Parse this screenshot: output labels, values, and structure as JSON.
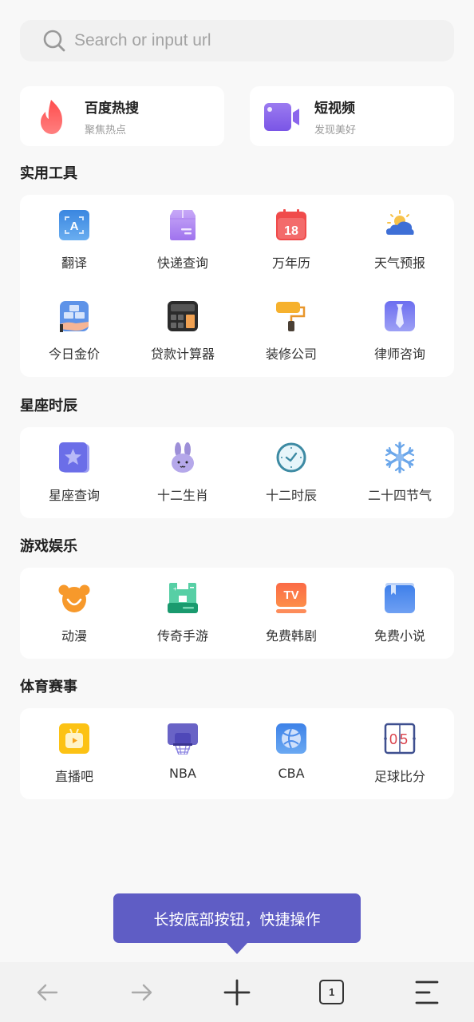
{
  "search": {
    "placeholder": "Search or input url",
    "value": ""
  },
  "features": [
    {
      "title": "百度热搜",
      "subtitle": "聚焦热点",
      "icon": "flame-icon"
    },
    {
      "title": "短视频",
      "subtitle": "发现美好",
      "icon": "video-camera-icon"
    }
  ],
  "sections": [
    {
      "title": "实用工具",
      "items": [
        {
          "label": "翻译",
          "icon": "translate-icon"
        },
        {
          "label": "快递查询",
          "icon": "package-icon"
        },
        {
          "label": "万年历",
          "icon": "calendar-icon",
          "icon_text": "18"
        },
        {
          "label": "天气预报",
          "icon": "weather-icon"
        },
        {
          "label": "今日金价",
          "icon": "gold-bars-icon"
        },
        {
          "label": "贷款计算器",
          "icon": "calculator-icon"
        },
        {
          "label": "装修公司",
          "icon": "paint-roller-icon"
        },
        {
          "label": "律师咨询",
          "icon": "necktie-icon"
        }
      ]
    },
    {
      "title": "星座时辰",
      "items": [
        {
          "label": "星座查询",
          "icon": "star-icon"
        },
        {
          "label": "十二生肖",
          "icon": "rabbit-icon"
        },
        {
          "label": "十二时辰",
          "icon": "clock-icon"
        },
        {
          "label": "二十四节气",
          "icon": "snowflake-icon"
        }
      ]
    },
    {
      "title": "游戏娱乐",
      "items": [
        {
          "label": "动漫",
          "icon": "bear-face-icon"
        },
        {
          "label": "传奇手游",
          "icon": "game-castle-icon"
        },
        {
          "label": "免费韩剧",
          "icon": "tv-icon",
          "icon_text": "TV"
        },
        {
          "label": "免费小说",
          "icon": "book-icon"
        }
      ]
    },
    {
      "title": "体育赛事",
      "items": [
        {
          "label": "直播吧",
          "icon": "live-tv-icon"
        },
        {
          "label": "NBA",
          "icon": "basketball-hoop-icon"
        },
        {
          "label": "CBA",
          "icon": "basketball-icon"
        },
        {
          "label": "足球比分",
          "icon": "scoreboard-icon",
          "icon_text": "05"
        }
      ]
    }
  ],
  "tooltip": {
    "text": "长按底部按钮，快捷操作"
  },
  "bottom_bar": {
    "tab_count": "1",
    "buttons": [
      "back-arrow-icon",
      "forward-arrow-icon",
      "plus-icon",
      "tabs-icon",
      "menu-icon"
    ]
  },
  "colors": {
    "accent": "#5f5dc5",
    "background": "#f8f8f8",
    "card": "#ffffff"
  }
}
